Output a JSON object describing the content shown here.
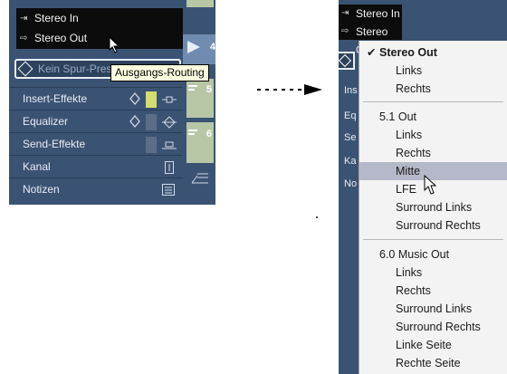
{
  "left": {
    "routing": {
      "input_label": "Stereo In",
      "output_label": "Stereo Out"
    },
    "preset_field": "Kein Spur-Pres",
    "tooltip": "Ausgangs-Routing",
    "sections": [
      {
        "label": "Insert-Effekte"
      },
      {
        "label": "Equalizer"
      },
      {
        "label": "Send-Effekte"
      },
      {
        "label": "Kanal"
      },
      {
        "label": "Notizen"
      }
    ],
    "track_numbers": [
      "4",
      "5",
      "6"
    ]
  },
  "right": {
    "routing": {
      "input_label": "Stereo In",
      "output_label": "Stereo Out"
    },
    "section_stubs": [
      "Ins",
      "Eq",
      "Se",
      "Ka",
      "No"
    ],
    "menu": {
      "groups": [
        {
          "title": "Stereo Out",
          "checked": true,
          "items": [
            "Links",
            "Rechts"
          ]
        },
        {
          "title": "5.1 Out",
          "checked": false,
          "items": [
            "Links",
            "Rechts",
            "Mitte",
            "LFE",
            "Surround Links",
            "Surround Rechts"
          ]
        },
        {
          "title": "6.0 Music Out",
          "checked": false,
          "items": [
            "Links",
            "Rechts",
            "Surround Links",
            "Surround Rechts",
            "Linke Seite",
            "Rechte Seite"
          ]
        }
      ],
      "highlighted": "Mitte",
      "check_glyph": "✔"
    }
  },
  "colors": {
    "panel": "#3b5373",
    "menu_bg": "#f3f3f3",
    "highlight": "#b4b8c8",
    "tooltip_bg": "#ffffe1",
    "track_green": "#b7c7a6"
  }
}
